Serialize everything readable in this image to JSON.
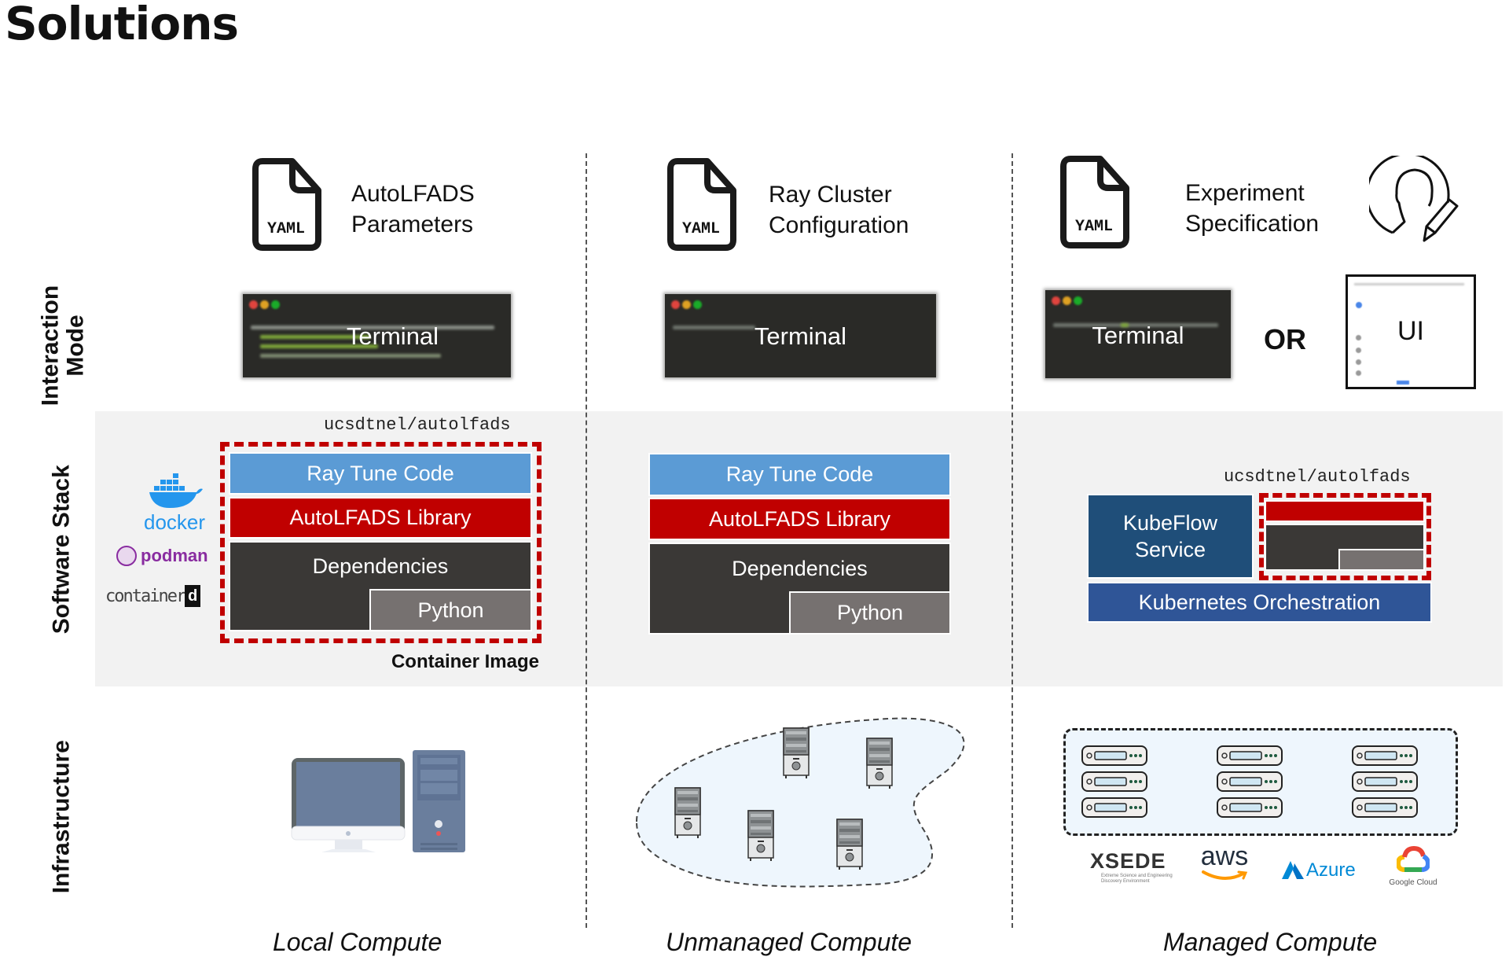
{
  "title": "Solutions",
  "row_labels": {
    "interaction": [
      "Interaction",
      "Mode"
    ],
    "software": "Software Stack",
    "infrastructure": "Infrastructure"
  },
  "columns": [
    {
      "name": "Local Compute",
      "spec_icon": "yaml-file-icon",
      "spec_icon_text": "YAML",
      "spec_lines": [
        "AutoLFADS",
        "Parameters"
      ],
      "terminal_label": "Terminal",
      "image_name": "ucsdtnel/autolfads",
      "stack": {
        "ray_tune": "Ray Tune Code",
        "library": "AutoLFADS Library",
        "dependencies": "Dependencies",
        "python": "Python"
      },
      "container_caption": "Container Image",
      "runtimes": [
        "docker",
        "podman",
        "containerd"
      ]
    },
    {
      "name": "Unmanaged Compute",
      "spec_icon": "yaml-file-icon",
      "spec_icon_text": "YAML",
      "spec_lines": [
        "Ray Cluster",
        "Configuration"
      ],
      "terminal_label": "Terminal",
      "stack": {
        "ray_tune": "Ray Tune Code",
        "library": "AutoLFADS Library",
        "dependencies": "Dependencies",
        "python": "Python"
      }
    },
    {
      "name": "Managed Compute",
      "spec_icon": "yaml-file-icon",
      "spec_icon_text": "YAML",
      "spec_lines": [
        "Experiment",
        "Specification"
      ],
      "terminal_label": "Terminal",
      "or_label": "OR",
      "ui_label": "UI",
      "image_name": "ucsdtnel/autolfads",
      "kubeflow_lines": [
        "KubeFlow",
        "Service"
      ],
      "kubernetes": "Kubernetes Orchestration",
      "providers": {
        "xsede": "XSEDE",
        "xsede_sub": [
          "Extreme Science and Engineering",
          "Discovery Environment"
        ],
        "aws": "aws",
        "azure": "Azure",
        "gcloud": "Google Cloud"
      }
    }
  ],
  "colors": {
    "ray_tune": "#5b9bd5",
    "library": "#c00000",
    "dependencies": "#3a3836",
    "python": "#767170",
    "kubeflow": "#1f4e79",
    "kubernetes": "#2f5597",
    "band": "#f2f2f2",
    "cluster_fill": "#eef6fd"
  }
}
